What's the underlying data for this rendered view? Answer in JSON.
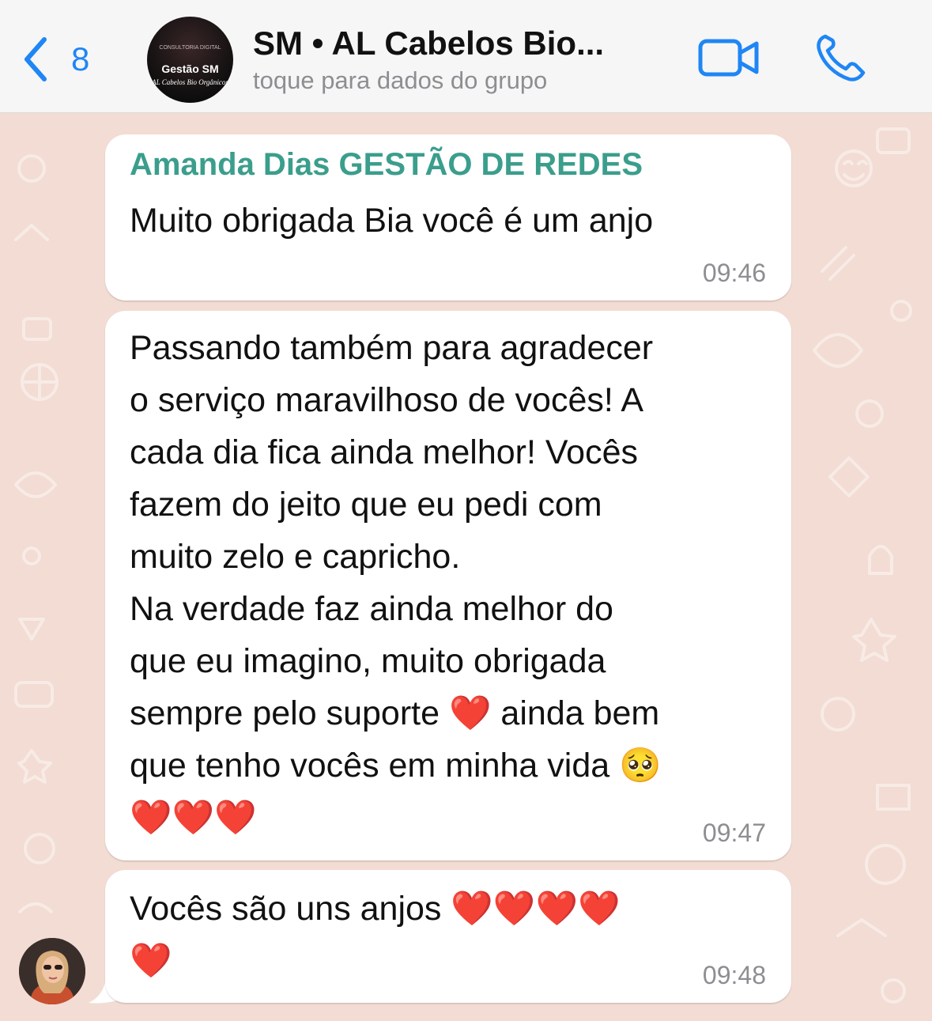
{
  "header": {
    "back_count": "8",
    "group_avatar_line1": "CONSULTORIA DIGITAL",
    "group_avatar_line2": "Gestão SM",
    "group_avatar_line3": "AL Cabelos Bio Orgânicos",
    "title": "SM • AL Cabelos Bio...",
    "subtitle": "toque para dados do grupo",
    "accent_color": "#1f86f5"
  },
  "messages": [
    {
      "sender": "Amanda Dias GESTÃO DE REDES",
      "sender_color": "#3b9e8c",
      "text": "Muito obrigada Bia você é um anjo",
      "time": "09:46"
    },
    {
      "text": "Passando também para agradecer\no serviço maravilhoso de vocês! A\ncada dia fica ainda melhor! Vocês\nfazem do jeito que eu pedi com\nmuito zelo e capricho.\nNa verdade faz ainda melhor do\nque eu imagino, muito obrigada\nsempre pelo suporte ❤️ ainda bem\nque tenho vocês em minha vida 🥺\n❤️❤️❤️",
      "time": "09:47"
    },
    {
      "text": "Vocês são uns anjos ❤️❤️❤️❤️\n❤️",
      "time": "09:48"
    }
  ],
  "icons": {
    "back": "chevron-left-icon",
    "video": "video-camera-icon",
    "phone": "phone-icon"
  },
  "chat_background_color": "#f2dcd3"
}
